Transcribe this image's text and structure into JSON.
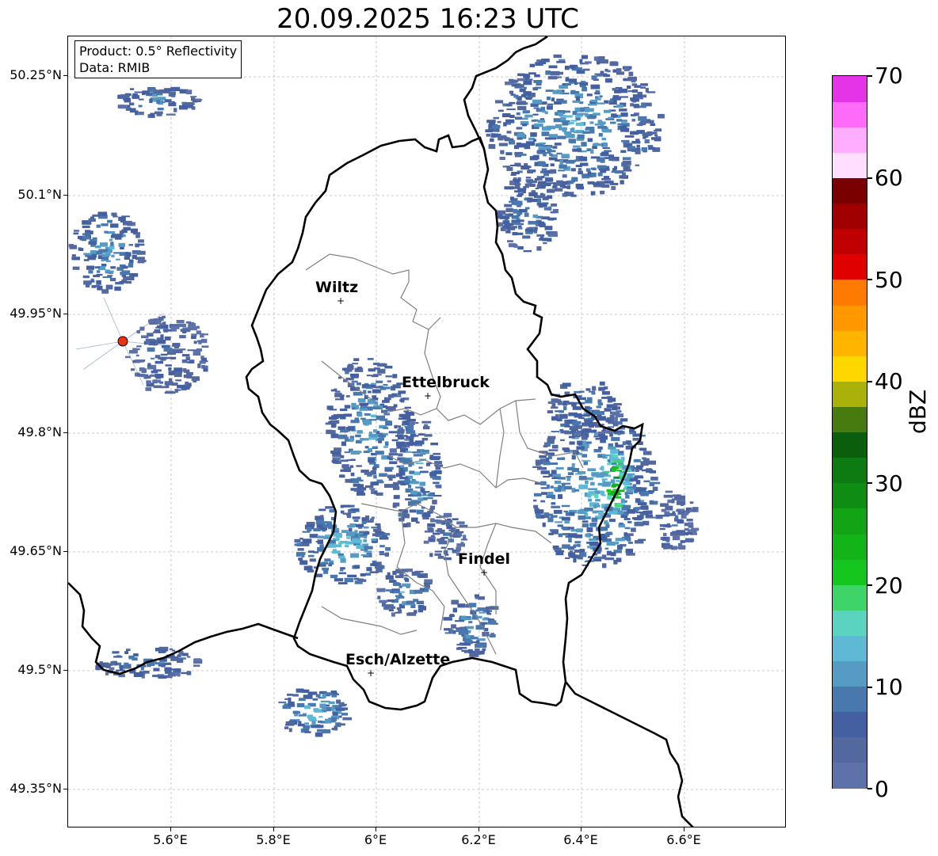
{
  "title": "20.09.2025 16:23 UTC",
  "info": {
    "product": "Product: 0.5° Reflectivity",
    "data": "Data: RMIB"
  },
  "lat_ticks": [
    "50.25°N",
    "50.1°N",
    "49.95°N",
    "49.8°N",
    "49.65°N",
    "49.5°N",
    "49.35°N"
  ],
  "lon_ticks": [
    "5.6°E",
    "5.8°E",
    "6°E",
    "6.2°E",
    "6.4°E",
    "6.6°E"
  ],
  "cities": [
    {
      "name": "Wiltz"
    },
    {
      "name": "Ettelbruck"
    },
    {
      "name": "Findel"
    },
    {
      "name": "Esch/Alzette"
    }
  ],
  "colorbar": {
    "label": "dBZ",
    "min": 0,
    "max": 70,
    "ticks": [
      "0",
      "10",
      "20",
      "30",
      "40",
      "50",
      "60",
      "70"
    ],
    "colors": [
      "#5e72a9",
      "#52689f",
      "#4560a0",
      "#4878ae",
      "#559bc4",
      "#5fb9d6",
      "#5ad3c0",
      "#3fd46a",
      "#14c61e",
      "#12b418",
      "#12a414",
      "#0f8c13",
      "#0e7a12",
      "#0b5f0c",
      "#477b0f",
      "#aab10a",
      "#ffd700",
      "#ffb500",
      "#ff9800",
      "#ff7a00",
      "#e00000",
      "#c00000",
      "#a00000",
      "#7a0000",
      "#ffdfff",
      "#ffaeff",
      "#ff6af9",
      "#e533e8"
    ]
  },
  "map_extent": {
    "lon": [
      5.4,
      6.8
    ],
    "lat": [
      49.3,
      50.3
    ]
  },
  "echoes": [
    {
      "lon": 5.98,
      "lat": 49.81,
      "rx": 0.08,
      "ry": 0.09,
      "dbz": 10
    },
    {
      "lon": 6.07,
      "lat": 49.75,
      "rx": 0.05,
      "ry": 0.07,
      "dbz": 10
    },
    {
      "lon": 5.93,
      "lat": 49.66,
      "rx": 0.09,
      "ry": 0.05,
      "dbz": 12
    },
    {
      "lon": 6.18,
      "lat": 49.56,
      "rx": 0.05,
      "ry": 0.04,
      "dbz": 10
    },
    {
      "lon": 6.42,
      "lat": 49.73,
      "rx": 0.12,
      "ry": 0.1,
      "dbz": 12
    },
    {
      "lon": 6.46,
      "lat": 49.74,
      "rx": 0.03,
      "ry": 0.04,
      "dbz": 25
    },
    {
      "lon": 6.4,
      "lat": 49.83,
      "rx": 0.07,
      "ry": 0.04,
      "dbz": 8
    },
    {
      "lon": 6.38,
      "lat": 50.19,
      "rx": 0.17,
      "ry": 0.09,
      "dbz": 10
    },
    {
      "lon": 6.29,
      "lat": 50.08,
      "rx": 0.06,
      "ry": 0.05,
      "dbz": 8
    },
    {
      "lon": 5.47,
      "lat": 50.03,
      "rx": 0.07,
      "ry": 0.05,
      "dbz": 10
    },
    {
      "lon": 5.59,
      "lat": 49.9,
      "rx": 0.08,
      "ry": 0.05,
      "dbz": 6
    },
    {
      "lon": 5.55,
      "lat": 49.51,
      "rx": 0.1,
      "ry": 0.02,
      "dbz": 8
    },
    {
      "lon": 5.87,
      "lat": 49.45,
      "rx": 0.07,
      "ry": 0.03,
      "dbz": 12
    },
    {
      "lon": 5.57,
      "lat": 50.22,
      "rx": 0.08,
      "ry": 0.02,
      "dbz": 8
    },
    {
      "lon": 6.58,
      "lat": 49.69,
      "rx": 0.04,
      "ry": 0.04,
      "dbz": 5
    },
    {
      "lon": 6.13,
      "lat": 49.67,
      "rx": 0.04,
      "ry": 0.03,
      "dbz": 6
    },
    {
      "lon": 6.05,
      "lat": 49.6,
      "rx": 0.05,
      "ry": 0.03,
      "dbz": 10
    }
  ],
  "colors": {
    "border": "#000000",
    "admin_border": "#808080",
    "grid": "#bbbbbb",
    "radar_site": "#ff2a00"
  }
}
